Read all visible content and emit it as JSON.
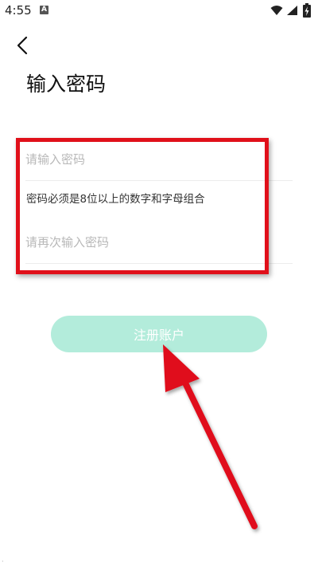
{
  "status_bar": {
    "time": "4:55",
    "icons": [
      "a-notification-icon",
      "wifi-icon",
      "signal-icon",
      "battery-charging-icon"
    ]
  },
  "header": {
    "back_icon": "chevron-left-icon",
    "title": "输入密码"
  },
  "form": {
    "password_placeholder": "请输入密码",
    "password_value": "",
    "hint": "密码必须是8位以上的数字和字母组合",
    "confirm_placeholder": "请再次输入密码",
    "confirm_value": ""
  },
  "register_button": {
    "label": "注册账户"
  },
  "colors": {
    "button_bg": "#b3ecdb",
    "annotation_red": "#e0101a",
    "placeholder": "#b8b8b8"
  }
}
